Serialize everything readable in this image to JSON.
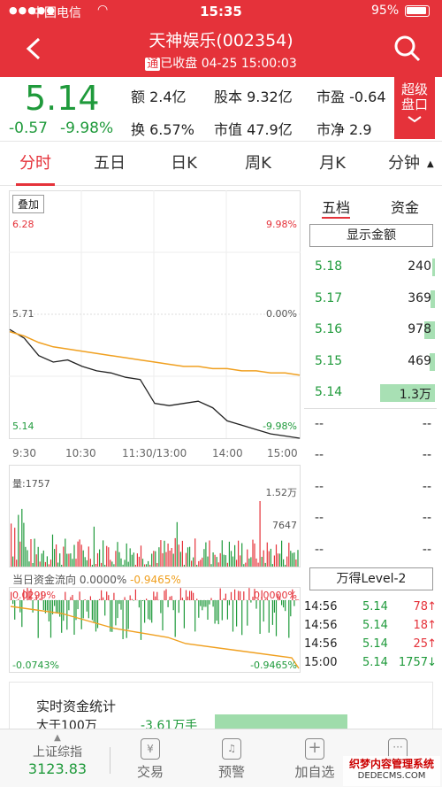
{
  "status_bar": {
    "carrier": "中国电信",
    "time": "15:35",
    "battery": "95%"
  },
  "header": {
    "title": "天神娱乐(002354)",
    "badge": "通",
    "subtitle": "已收盘 04-25 15:00:03",
    "super_label_1": "超级",
    "super_label_2": "盘口"
  },
  "quote": {
    "price": "5.14",
    "change": "-0.57",
    "change_pct": "-9.98%",
    "stats": [
      {
        "label": "额",
        "value": "2.4亿"
      },
      {
        "label": "股本",
        "value": "9.32亿"
      },
      {
        "label": "市盈",
        "value": "-0.64"
      },
      {
        "label": "换",
        "value": "6.57%"
      },
      {
        "label": "市值",
        "value": "47.9亿"
      },
      {
        "label": "市净",
        "value": "2.9"
      }
    ]
  },
  "tabs": [
    "分时",
    "五日",
    "日K",
    "周K",
    "月K",
    "分钟"
  ],
  "chart": {
    "overlay_button": "叠加",
    "price_high": "6.28",
    "price_mid": "5.71",
    "price_low": "5.14",
    "pct_high": "9.98%",
    "pct_mid": "0.00%",
    "pct_low": "-9.98%",
    "time_labels": [
      "9:30",
      "10:30",
      "11:30/13:00",
      "14:00",
      "15:00"
    ],
    "volume_label": "量:1757",
    "volume_max": "1.52万",
    "volume_mid": "7647",
    "flow_title": "当日资金流向",
    "flow_pct_a": "0.0000%",
    "flow_pct_b": "-0.9465%",
    "flow_top_left": "0.0299%",
    "flow_top_right": "0.0000%",
    "flow_bottom_left": "-0.0743%",
    "flow_bottom_right": "-0.9465%"
  },
  "chart_data": {
    "type": "line",
    "x_labels": [
      "9:30",
      "10:30",
      "11:30/13:00",
      "14:00",
      "15:00"
    ],
    "ylim": [
      5.14,
      6.28
    ],
    "series": [
      {
        "values": [
          5.64,
          5.6,
          5.52,
          5.49,
          5.5,
          5.47,
          5.45,
          5.44,
          5.42,
          5.41,
          5.3,
          5.29,
          5.3,
          5.31,
          5.28,
          5.22,
          5.2,
          5.18,
          5.16,
          5.15,
          5.14
        ]
      },
      {
        "values": [
          5.63,
          5.61,
          5.58,
          5.56,
          5.55,
          5.54,
          5.53,
          5.52,
          5.51,
          5.5,
          5.49,
          5.48,
          5.47,
          5.47,
          5.46,
          5.46,
          5.45,
          5.45,
          5.44,
          5.44,
          5.43
        ]
      }
    ]
  },
  "right_panel": {
    "tab_five": "五档",
    "tab_fund": "资金",
    "show_amount": "显示金额",
    "levels": [
      {
        "price": "5.18",
        "volume": "240",
        "bar": 0.05
      },
      {
        "price": "5.17",
        "volume": "369",
        "bar": 0.08
      },
      {
        "price": "5.16",
        "volume": "978",
        "bar": 0.2
      },
      {
        "price": "5.15",
        "volume": "469",
        "bar": 0.09
      },
      {
        "price": "5.14",
        "volume": "1.3万",
        "bar": 1.0
      },
      {
        "price": "--",
        "volume": "--",
        "bar": 0
      },
      {
        "price": "--",
        "volume": "--",
        "bar": 0
      },
      {
        "price": "--",
        "volume": "--",
        "bar": 0
      },
      {
        "price": "--",
        "volume": "--",
        "bar": 0
      },
      {
        "price": "--",
        "volume": "--",
        "bar": 0
      }
    ],
    "level2_button": "万得Level-2",
    "trades": [
      {
        "time": "14:56",
        "price": "5.14",
        "vol": "78",
        "dir": "↑"
      },
      {
        "time": "14:56",
        "price": "5.14",
        "vol": "18",
        "dir": "↑"
      },
      {
        "time": "14:56",
        "price": "5.14",
        "vol": "25",
        "dir": "↑"
      },
      {
        "time": "15:00",
        "price": "5.14",
        "vol": "1757",
        "dir": "↓"
      }
    ]
  },
  "stats": {
    "title": "实时资金统计",
    "row_label": "大于100万",
    "row_value": "-3.61万手"
  },
  "bottom_nav": {
    "index_name": "上证综指",
    "index_value": "3123.83",
    "trade": "交易",
    "alert": "预警",
    "add_watch": "加自选",
    "watermark": "织梦内容管理系统",
    "watermark_url": "DEDECMS.COM"
  },
  "colors": {
    "brand_red": "#e5323a",
    "down_green": "#1f9a3b",
    "avg_orange": "#f0a020"
  }
}
